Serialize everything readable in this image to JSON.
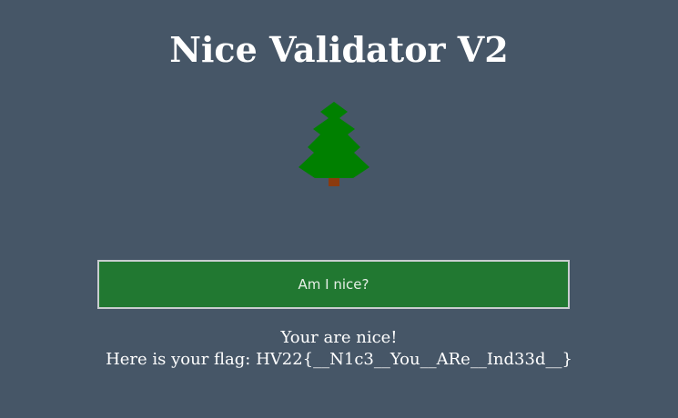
{
  "header": {
    "title": "Nice Validator V2"
  },
  "icons": {
    "tree": "christmas-tree-icon"
  },
  "colors": {
    "background": "#465667",
    "button_bg": "#217831",
    "tree_green": "#008000",
    "tree_trunk": "#8b3a0e"
  },
  "main": {
    "button_label": "Am I nice?",
    "result_line1": "Your are nice!",
    "result_line2": "Here is your flag: HV22{__N1c3__You__ARe__Ind33d__}"
  }
}
